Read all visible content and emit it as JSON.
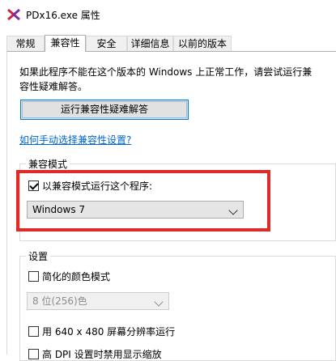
{
  "window": {
    "title": "PDx16.exe 属性"
  },
  "tabs": [
    {
      "label": "常规"
    },
    {
      "label": "兼容性"
    },
    {
      "label": "安全"
    },
    {
      "label": "详细信息"
    },
    {
      "label": "以前的版本"
    }
  ],
  "main": {
    "intro_line1": "如果此程序不能在这个版本的 Windows 上正常工作，请尝试运行兼",
    "intro_line2": "容性疑难解答。",
    "troubleshoot_button": "运行兼容性疑难解答",
    "manual_link": "如何手动选择兼容性设置?"
  },
  "compat_mode": {
    "group_label": "兼容模式",
    "checkbox_label": "以兼容模式运行这个程序:",
    "checked": true,
    "selected_os": "Windows 7"
  },
  "settings": {
    "group_label": "设置",
    "reduced_color_label": "简化的颜色模式",
    "color_select": "8 位(256)色",
    "resolution_label": "用 640 x 480 屏幕分辨率运行",
    "dpi_label": "高 DPI 设置时禁用显示缩放"
  },
  "colors": {
    "highlight": "#e02a2a",
    "link": "#0066cc",
    "focus": "#0078d7"
  }
}
